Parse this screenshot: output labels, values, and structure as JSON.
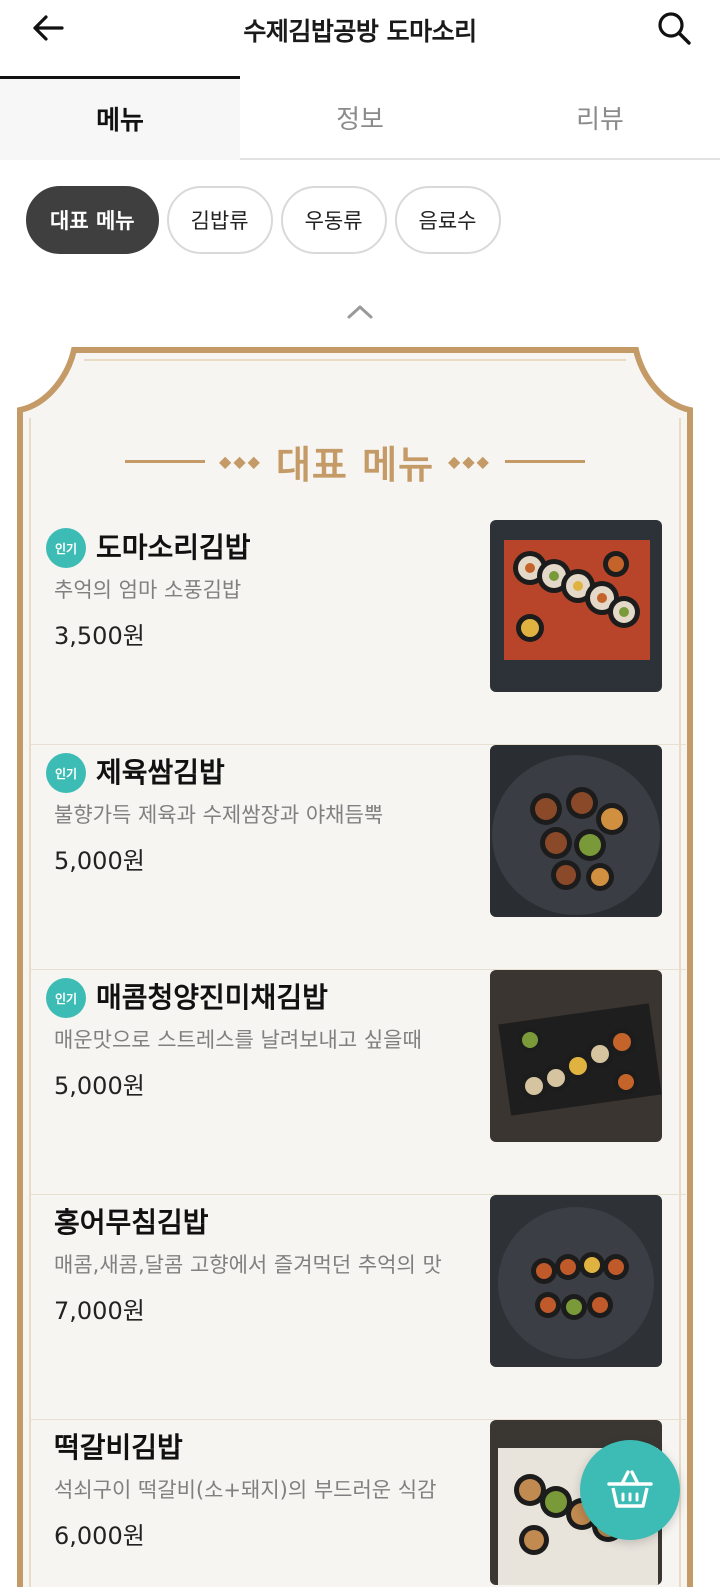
{
  "header": {
    "title": "수제김밥공방 도마소리"
  },
  "tabs": [
    {
      "label": "메뉴",
      "active": true
    },
    {
      "label": "정보",
      "active": false
    },
    {
      "label": "리뷰",
      "active": false
    }
  ],
  "chips": [
    {
      "label": "대표 메뉴",
      "active": true
    },
    {
      "label": "김밥류",
      "active": false
    },
    {
      "label": "우동류",
      "active": false
    },
    {
      "label": "음료수",
      "active": false
    }
  ],
  "board": {
    "title": "대표 메뉴"
  },
  "menu_items": [
    {
      "badge": "인기",
      "name": "도마소리김밥",
      "desc": "추억의 엄마 소풍김밥",
      "price": "3,500원"
    },
    {
      "badge": "인기",
      "name": "제육쌈김밥",
      "desc": "불향가득 제육과 수제쌈장과 야채듬뿍",
      "price": "5,000원"
    },
    {
      "badge": "인기",
      "name": "매콤청양진미채김밥",
      "desc": "매운맛으로 스트레스를 날려보내고 싶을때",
      "price": "5,000원"
    },
    {
      "badge": "",
      "name": "홍어무침김밥",
      "desc": "매콤,새콤,달콤 고향에서 즐겨먹던 추억의 맛",
      "price": "7,000원"
    },
    {
      "badge": "",
      "name": "떡갈비김밥",
      "desc": "석쇠구이 떡갈비(소+돼지)의 부드러운 식감",
      "price": "6,000원"
    }
  ],
  "colors": {
    "accent": "#3cbcb4",
    "frame": "#c49a66",
    "chip_active": "#3f3f3f"
  },
  "icons": {
    "back": "arrow-left-icon",
    "search": "search-icon",
    "cart": "basket-icon",
    "collapse": "chevron-up-icon"
  }
}
